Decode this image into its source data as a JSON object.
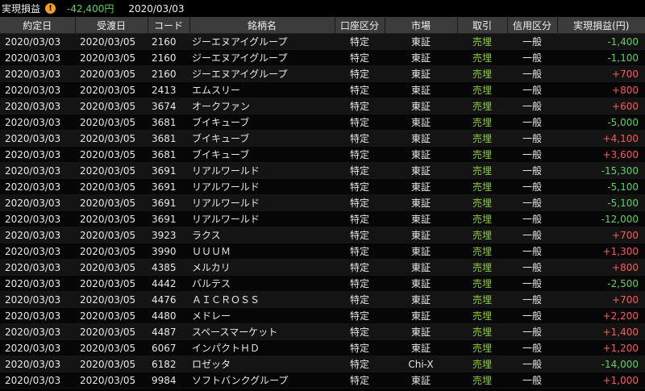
{
  "summary": {
    "title": "実現損益",
    "warning_icon": "!",
    "total": "-42,400円",
    "date": "2020/03/03"
  },
  "colors": {
    "positive": "#ff5a5a",
    "negative": "#5fd35f",
    "trade": "#8dcc3c",
    "header_bg": "#3c3c3c"
  },
  "table": {
    "columns": [
      "約定日",
      "受渡日",
      "コード",
      "銘柄名",
      "口座区分",
      "市場",
      "取引",
      "信用区分",
      "実現損益(円)"
    ],
    "rows": [
      [
        "2020/03/03",
        "2020/03/05",
        "2160",
        "ジーエヌアイグループ",
        "特定",
        "東証",
        "売埋",
        "一般",
        "-1,400"
      ],
      [
        "2020/03/03",
        "2020/03/05",
        "2160",
        "ジーエヌアイグループ",
        "特定",
        "東証",
        "売埋",
        "一般",
        "-1,100"
      ],
      [
        "2020/03/03",
        "2020/03/05",
        "2160",
        "ジーエヌアイグループ",
        "特定",
        "東証",
        "売埋",
        "一般",
        "+700"
      ],
      [
        "2020/03/03",
        "2020/03/05",
        "2413",
        "エムスリー",
        "特定",
        "東証",
        "売埋",
        "一般",
        "+800"
      ],
      [
        "2020/03/03",
        "2020/03/05",
        "3674",
        "オークファン",
        "特定",
        "東証",
        "売埋",
        "一般",
        "+600"
      ],
      [
        "2020/03/03",
        "2020/03/05",
        "3681",
        "ブイキューブ",
        "特定",
        "東証",
        "売埋",
        "一般",
        "-5,000"
      ],
      [
        "2020/03/03",
        "2020/03/05",
        "3681",
        "ブイキューブ",
        "特定",
        "東証",
        "売埋",
        "一般",
        "+4,100"
      ],
      [
        "2020/03/03",
        "2020/03/05",
        "3681",
        "ブイキューブ",
        "特定",
        "東証",
        "売埋",
        "一般",
        "+3,600"
      ],
      [
        "2020/03/03",
        "2020/03/05",
        "3691",
        "リアルワールド",
        "特定",
        "東証",
        "売埋",
        "一般",
        "-15,300"
      ],
      [
        "2020/03/03",
        "2020/03/05",
        "3691",
        "リアルワールド",
        "特定",
        "東証",
        "売埋",
        "一般",
        "-5,100"
      ],
      [
        "2020/03/03",
        "2020/03/05",
        "3691",
        "リアルワールド",
        "特定",
        "東証",
        "売埋",
        "一般",
        "-5,100"
      ],
      [
        "2020/03/03",
        "2020/03/05",
        "3691",
        "リアルワールド",
        "特定",
        "東証",
        "売埋",
        "一般",
        "-12,000"
      ],
      [
        "2020/03/03",
        "2020/03/05",
        "3923",
        "ラクス",
        "特定",
        "東証",
        "売埋",
        "一般",
        "+700"
      ],
      [
        "2020/03/03",
        "2020/03/05",
        "3990",
        "ＵＵＵＭ",
        "特定",
        "東証",
        "売埋",
        "一般",
        "+1,300"
      ],
      [
        "2020/03/03",
        "2020/03/05",
        "4385",
        "メルカリ",
        "特定",
        "東証",
        "売埋",
        "一般",
        "+800"
      ],
      [
        "2020/03/03",
        "2020/03/05",
        "4442",
        "バルテス",
        "特定",
        "東証",
        "売埋",
        "一般",
        "-2,500"
      ],
      [
        "2020/03/03",
        "2020/03/05",
        "4476",
        "ＡＩＣＲＯＳＳ",
        "特定",
        "東証",
        "売埋",
        "一般",
        "+700"
      ],
      [
        "2020/03/03",
        "2020/03/05",
        "4480",
        "メドレー",
        "特定",
        "東証",
        "売埋",
        "一般",
        "+2,200"
      ],
      [
        "2020/03/03",
        "2020/03/05",
        "4487",
        "スペースマーケット",
        "特定",
        "東証",
        "売埋",
        "一般",
        "+1,400"
      ],
      [
        "2020/03/03",
        "2020/03/05",
        "6067",
        "インパクトＨＤ",
        "特定",
        "東証",
        "売埋",
        "一般",
        "+1,200"
      ],
      [
        "2020/03/03",
        "2020/03/05",
        "6182",
        "ロゼッタ",
        "特定",
        "Chi-X",
        "売埋",
        "一般",
        "-14,000"
      ],
      [
        "2020/03/03",
        "2020/03/05",
        "9984",
        "ソフトバンクグループ",
        "特定",
        "東証",
        "売埋",
        "一般",
        "+1,000"
      ]
    ]
  }
}
